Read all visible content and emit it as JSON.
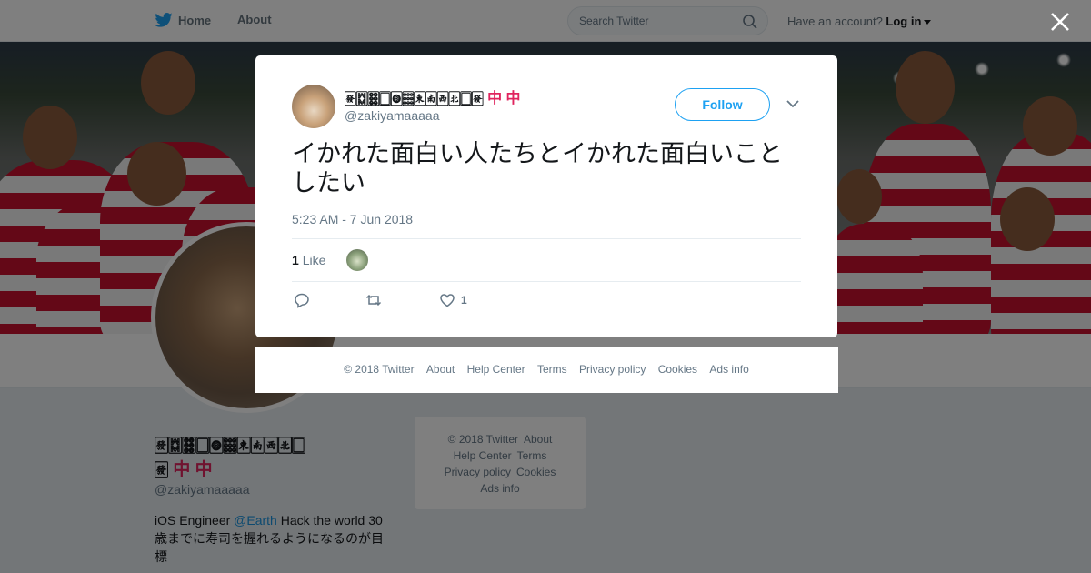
{
  "topbar": {
    "home_label": "Home",
    "about_label": "About",
    "search_placeholder": "Search Twitter",
    "account_prompt": "Have an account?",
    "login_label": "Log in"
  },
  "profile": {
    "name_line1": "🀅🀗🀞🀆🀙🀡🀀🀁🀂🀃🀆",
    "name_line2": "🀅",
    "name_red": "中 中",
    "handle": "@zakiyamaaaaa",
    "bio_prefix": "iOS Engineer ",
    "bio_mention": "@Earth",
    "bio_suffix": " Hack the world 30歳までに寿司を握れるようになるのが目標"
  },
  "side_footer": {
    "copyright": "© 2018 Twitter",
    "about": "About",
    "help": "Help Center",
    "terms": "Terms",
    "privacy": "Privacy policy",
    "cookies": "Cookies",
    "ads": "Ads info"
  },
  "tweet": {
    "name": "🀅🀗🀞🀆🀙🀡🀀🀁🀂🀃🀆🀅",
    "name_red": "中 中",
    "handle": "@zakiyamaaaaa",
    "follow_label": "Follow",
    "text": "イかれた面白い人たちとイかれた面白いことしたい",
    "timestamp": "5:23 AM - 7 Jun 2018",
    "likes_count": "1",
    "likes_label": "Like",
    "like_action_count": "1"
  },
  "modal_footer": {
    "copyright": "© 2018 Twitter",
    "about": "About",
    "help": "Help Center",
    "terms": "Terms",
    "privacy": "Privacy policy",
    "cookies": "Cookies",
    "ads": "Ads info"
  },
  "colors": {
    "twitter_blue": "#1da1f2",
    "rugby_red": "#c8102e",
    "like_heart": "#657786"
  },
  "icons": [
    "twitter-bird-icon",
    "search-icon",
    "close-icon",
    "chevron-down-icon",
    "reply-icon",
    "retweet-icon",
    "heart-icon"
  ]
}
